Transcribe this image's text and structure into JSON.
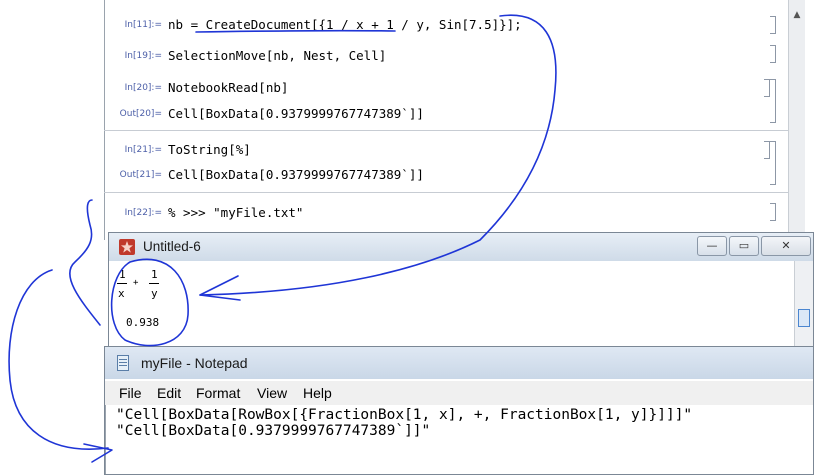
{
  "notebook": {
    "cells": [
      {
        "label": "In[11]:=",
        "code": "nb = CreateDocument[{1 / x + 1 / y, Sin[7.5]}];"
      },
      {
        "label": "In[19]:=",
        "code": "SelectionMove[nb, Nest, Cell]"
      },
      {
        "label": "In[20]:=",
        "code": "NotebookRead[nb]"
      },
      {
        "label": "Out[20]=",
        "code": "Cell[BoxData[0.9379999767747389`]]"
      },
      {
        "label": "In[21]:=",
        "code": "ToString[%]"
      },
      {
        "label": "Out[21]=",
        "code": "Cell[BoxData[0.9379999767747389`]]"
      },
      {
        "label": "In[22]:=",
        "code": "% >>> \"myFile.txt\""
      }
    ]
  },
  "untitled_window": {
    "title": "Untitled-6",
    "frac1": {
      "num": "1",
      "den": "x"
    },
    "plus": "+",
    "frac2": {
      "num": "1",
      "den": "y"
    },
    "value": "0.938",
    "buttons": {
      "minimize": "—",
      "restore": "▭",
      "close": "✕"
    }
  },
  "notepad_window": {
    "title": "myFile - Notepad",
    "menu": [
      "File",
      "Edit",
      "Format",
      "View",
      "Help"
    ],
    "lines": [
      "\"Cell[BoxData[RowBox[{FractionBox[1, x], +, FractionBox[1, y]}]]]\"",
      "\"Cell[BoxData[0.9379999767747389`]]\""
    ]
  },
  "colors": {
    "label_blue": "#4c5fa8",
    "ink": "#1f35d6",
    "highlight_blue": "#3355cc"
  }
}
